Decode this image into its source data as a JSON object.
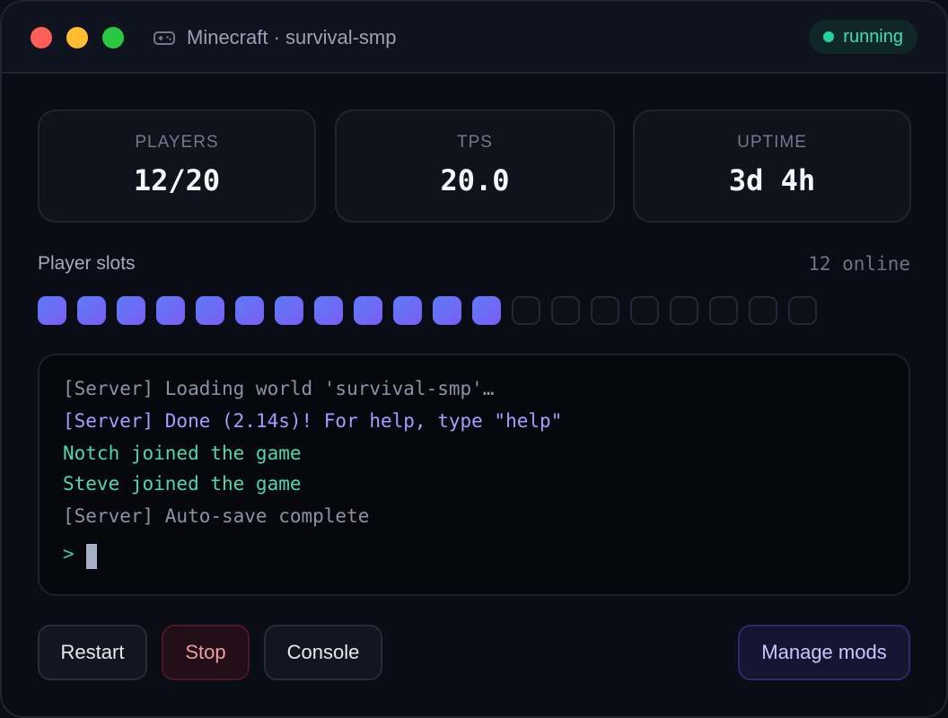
{
  "window": {
    "title": "Minecraft · survival-smp",
    "status": "running"
  },
  "stats": [
    {
      "label": "PLAYERS",
      "value": "12/20"
    },
    {
      "label": "TPS",
      "value": "20.0"
    },
    {
      "label": "UPTIME",
      "value": "3d 4h"
    }
  ],
  "slots": {
    "title": "Player slots",
    "online_label": "12 online",
    "filled": 12,
    "total": 20
  },
  "console": {
    "lines": [
      "[Server] Loading world 'survival-smp'…",
      "[Server] Done (2.14s)! For help, type \"help\"",
      "Notch joined the game",
      "Steve joined the game",
      "[Server] Auto-save complete"
    ],
    "prompt": ">"
  },
  "buttons": {
    "restart": "Restart",
    "stop": "Stop",
    "console": "Console",
    "manage_mods": "Manage mods"
  },
  "colors": {
    "status_accent": "#22d3a0",
    "slot_filled_start": "#5b7cf7",
    "slot_filled_end": "#7c5cf4",
    "console_info": "#a79cff",
    "console_join": "#4fd9a8",
    "danger": "#f19aa0"
  },
  "icons": {
    "title": "gamepad-icon",
    "status": "status-dot-icon"
  }
}
